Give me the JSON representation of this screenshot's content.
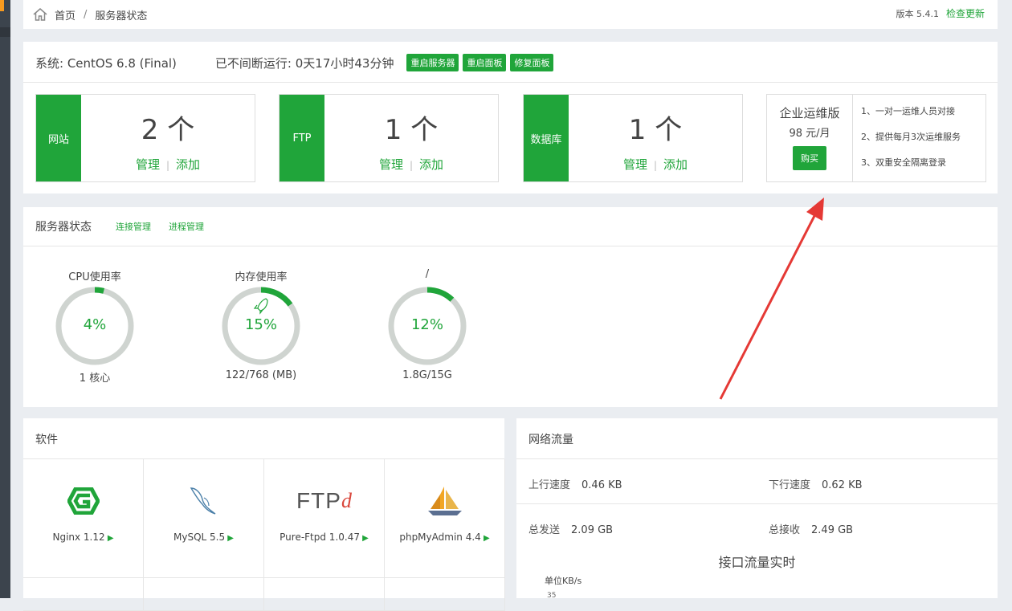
{
  "breadcrumb": {
    "home": "首页",
    "separator": "/",
    "current": "服务器状态"
  },
  "version": {
    "label": "版本 5.4.1",
    "check_update": "检查更新"
  },
  "system": {
    "os": "系统: CentOS 6.8 (Final)",
    "uptime": "已不间断运行: 0天17小时43分钟",
    "buttons": [
      "重启服务器",
      "重启面板",
      "修复面板"
    ]
  },
  "cards": [
    {
      "tag": "网站",
      "count": "2 个",
      "manage": "管理",
      "add": "添加"
    },
    {
      "tag": "FTP",
      "count": "1 个",
      "manage": "管理",
      "add": "添加"
    },
    {
      "tag": "数据库",
      "count": "1 个",
      "manage": "管理",
      "add": "添加"
    }
  ],
  "enterprise": {
    "title": "企业运维版",
    "price": "98 元/月",
    "buy": "购买",
    "features": [
      "1、一对一运维人员对接",
      "2、提供每月3次运维服务",
      "3、双重安全隔离登录"
    ]
  },
  "server_status": {
    "title": "服务器状态",
    "links": [
      "连接管理",
      "进程管理"
    ],
    "gauges": [
      {
        "label": "CPU使用率",
        "percent": "4%",
        "value": 4,
        "sub": "1 核心"
      },
      {
        "label": "内存使用率",
        "percent": "15%",
        "value": 15,
        "sub": "122/768 (MB)"
      },
      {
        "label": "/",
        "percent": "12%",
        "value": 12,
        "sub": "1.8G/15G"
      }
    ]
  },
  "software": {
    "title": "软件",
    "items": [
      {
        "name": "Nginx 1.12",
        "icon": "nginx-icon"
      },
      {
        "name": "MySQL 5.5",
        "icon": "mysql-dolphin-icon"
      },
      {
        "name": "Pure-Ftpd 1.0.47",
        "icon": "ftpd-logo-icon",
        "logo_text": "FTP",
        "logo_d": "d"
      },
      {
        "name": "phpMyAdmin 4.4",
        "icon": "phpmyadmin-sailboat-icon"
      }
    ]
  },
  "network": {
    "title": "网络流量",
    "up_label": "上行速度",
    "up_value": "0.46 KB",
    "down_label": "下行速度",
    "down_value": "0.62 KB",
    "sent_label": "总发送",
    "sent_value": "2.09 GB",
    "recv_label": "总接收",
    "recv_value": "2.49 GB",
    "chart_title": "接口流量实时",
    "unit": "单位KB/s",
    "ytick": "35"
  },
  "colors": {
    "accent": "#20a53a",
    "arrow": "#e53935",
    "ring_track": "#cfd4d0"
  }
}
